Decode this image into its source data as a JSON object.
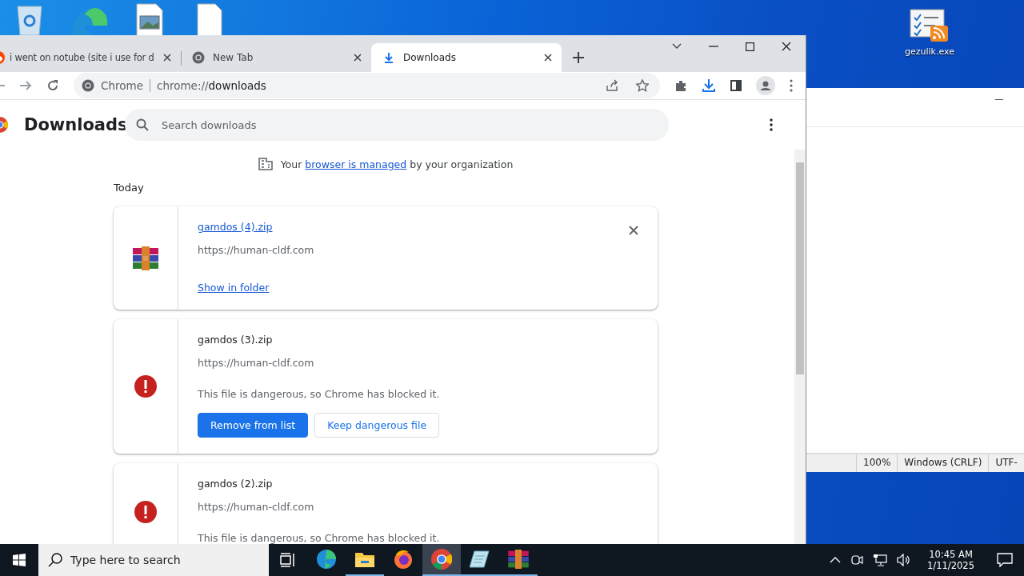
{
  "desktop": {
    "icons": [
      {
        "label": "gezulik.exe"
      }
    ]
  },
  "browser": {
    "tabs": [
      {
        "title": "i went on notube (site i use for d",
        "kind": "reddit",
        "selected": false
      },
      {
        "title": "New Tab",
        "kind": "chrome",
        "selected": false
      },
      {
        "title": "Downloads",
        "kind": "download",
        "selected": true
      }
    ],
    "omnibox": {
      "site": "Chrome",
      "host": "chrome://",
      "path": "downloads"
    },
    "page": {
      "title": "Downloads",
      "search_placeholder": "Search downloads",
      "notice": {
        "before": "Your",
        "link": "browser is managed",
        "after": "by your organization"
      },
      "date_heading": "Today",
      "downloads": [
        {
          "kind": "complete",
          "file": "gamdos (4).zip",
          "url": "https://human-cldf.com",
          "action": "Show in folder"
        },
        {
          "kind": "dangerous",
          "file": "gamdos (3).zip",
          "url": "https://human-cldf.com",
          "warning": "This file is dangerous, so Chrome has blocked it.",
          "buttons": [
            "Remove from list",
            "Keep dangerous file"
          ]
        },
        {
          "kind": "dangerous",
          "file": "gamdos (2).zip",
          "url": "https://human-cldf.com",
          "warning": "This file is dangerous, so Chrome has blocked it."
        }
      ]
    }
  },
  "notepad": {
    "status": [
      "100%",
      "Windows (CRLF)",
      "UTF-"
    ]
  },
  "taskbar": {
    "search_placeholder": "Type here to search",
    "apps": [
      {
        "kind": "edge",
        "selected": false,
        "running": false
      },
      {
        "kind": "folder",
        "selected": false,
        "running": true
      },
      {
        "kind": "firefox",
        "selected": false,
        "running": false
      },
      {
        "kind": "chrome",
        "selected": true,
        "running": true
      },
      {
        "kind": "notepad",
        "selected": false,
        "running": true
      },
      {
        "kind": "archive",
        "selected": false,
        "running": true
      }
    ],
    "time": "10:45 AM",
    "date": "1/11/2025"
  }
}
